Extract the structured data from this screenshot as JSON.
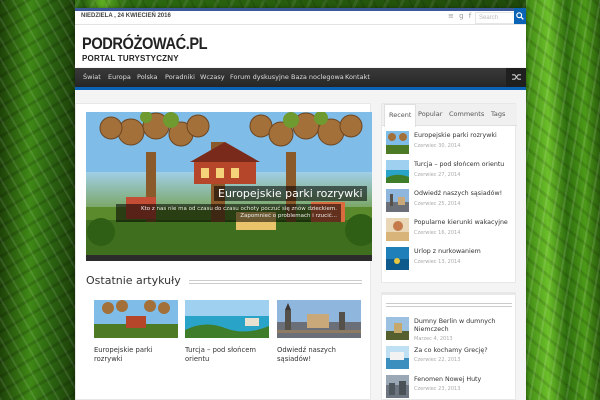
{
  "colors": {
    "accent": "#0b63b6",
    "nav_bg": "#2e2e2e",
    "top_border": "#3b5998"
  },
  "topbar": {
    "date": "NIEDZIELA , 24 KWIECIEŃ 2016",
    "social_icons": [
      "rss-icon",
      "google-plus-icon",
      "facebook-icon"
    ],
    "search_placeholder": "Search",
    "search_icon": "search-icon"
  },
  "header": {
    "title": "PODRÓŻOWAĆ.PL",
    "subtitle": "PORTAL TURYSTYCZNY"
  },
  "nav": {
    "items": [
      "Świat",
      "Europa",
      "Polska",
      "Poradniki",
      "Wczasy",
      "Forum dyskusyjne",
      "Baza noclegowa",
      "Kontakt"
    ],
    "random_icon": "shuffle-icon"
  },
  "slider": {
    "title": "Europejskie parki rozrywki",
    "text": "Kto z nas nie ma od czasu do czasu ochoty poczuć się znów dzieckiem. Zapomnieć o problemach i rzucić..."
  },
  "latest": {
    "heading": "Ostatnie artykuły",
    "articles": [
      {
        "title": "Europejskie parki rozrywki"
      },
      {
        "title": "Turcja – pod słońcem orientu"
      },
      {
        "title": "Odwiedź naszych sąsiadów!"
      }
    ]
  },
  "sidebar": {
    "tabs": [
      "Recent",
      "Popular",
      "Comments",
      "Tags"
    ],
    "active_tab": "Recent",
    "posts": [
      {
        "title": "Europejskie parki rozrywki",
        "date": "Czerwiec 30, 2014"
      },
      {
        "title": "Turcja – pod słońcem orientu",
        "date": "Czerwiec 27, 2014"
      },
      {
        "title": "Odwiedź naszych sąsiadów!",
        "date": "Czerwiec 25, 2014"
      },
      {
        "title": "Popularne kierunki wakacyjne",
        "date": "Czerwiec 16, 2014"
      },
      {
        "title": "Urlop z nurkowaniem",
        "date": "Czerwiec 13, 2014"
      }
    ],
    "posts2": [
      {
        "title": "Dumny Berlin w dumnych Niemczech",
        "date": "Marzec 4, 2013"
      },
      {
        "title": "Za co kochamy Grecję?",
        "date": "Czerwiec 22, 2013"
      },
      {
        "title": "Fenomen Nowej Huty",
        "date": "Czerwiec 23, 2013"
      }
    ]
  }
}
